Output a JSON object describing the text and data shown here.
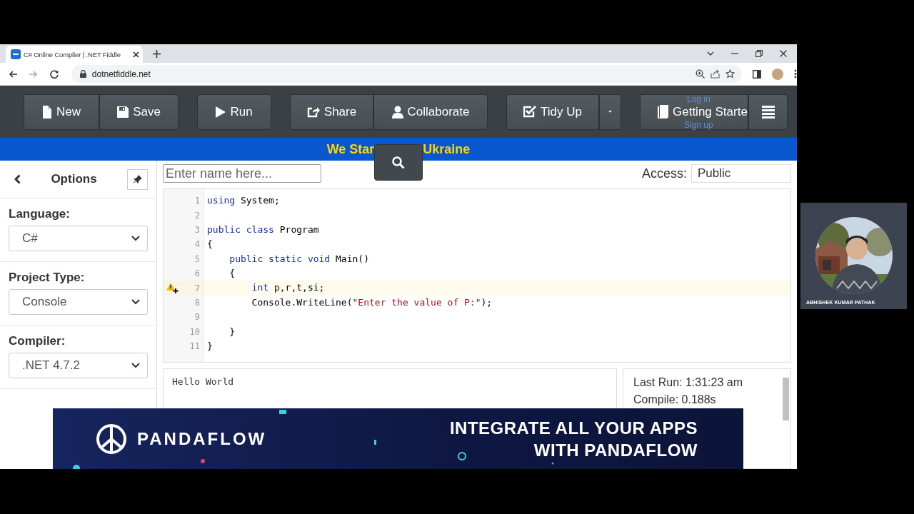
{
  "browser": {
    "tab": {
      "title": "C# Online Compiler | .NET Fiddle"
    },
    "nav": [
      {
        "kind": "back",
        "disabled": false
      },
      {
        "kind": "forward",
        "disabled": true
      },
      {
        "kind": "reload",
        "disabled": false
      }
    ],
    "address": "dotnetfiddle.net"
  },
  "toolbar": {
    "groups": [
      [
        {
          "kind": "new",
          "label": "New"
        },
        {
          "kind": "save",
          "label": "Save"
        }
      ],
      [
        {
          "kind": "run",
          "label": "Run"
        }
      ],
      [
        {
          "kind": "share",
          "label": "Share"
        },
        {
          "kind": "collaborate",
          "label": "Collaborate"
        }
      ],
      [
        {
          "kind": "tidy",
          "label": "Tidy Up"
        },
        {
          "kind": "caret"
        }
      ],
      [
        {
          "kind": "guide",
          "label": "Getting Starte"
        },
        {
          "kind": "menu"
        }
      ]
    ],
    "account_links": [
      "Log in",
      "Sign up"
    ]
  },
  "banner": {
    "parts": [
      "We Star",
      "Ukraine"
    ]
  },
  "sidebar": {
    "title": "Options",
    "fields": [
      {
        "label": "Language:",
        "value": "C#"
      },
      {
        "label": "Project Type:",
        "value": "Console"
      },
      {
        "label": "Compiler:",
        "value": ".NET 4.7.2"
      }
    ]
  },
  "name_field": {
    "placeholder": "Enter name here..."
  },
  "access": {
    "label": "Access:",
    "value": "Public"
  },
  "editor": {
    "lines": [
      {
        "number": "1",
        "warning": false,
        "tokens": [
          {
            "text": "using",
            "kind": "keyword"
          },
          {
            "text": " System;",
            "kind": "plain"
          }
        ]
      },
      {
        "number": "2",
        "warning": false
      },
      {
        "number": "3",
        "warning": false,
        "tokens": [
          {
            "text": "public class",
            "kind": "keyword"
          },
          {
            "text": " Program",
            "kind": "plain"
          }
        ]
      },
      {
        "number": "4",
        "warning": false,
        "tokens": [
          {
            "text": "{",
            "kind": "plain"
          }
        ]
      },
      {
        "number": "5",
        "warning": false,
        "tokens": [
          {
            "text": "    public static void",
            "kind": "keyword"
          },
          {
            "text": " Main()",
            "kind": "plain"
          }
        ]
      },
      {
        "number": "6",
        "warning": false,
        "tokens": [
          {
            "text": "    {",
            "kind": "plain"
          }
        ]
      },
      {
        "number": "7",
        "warning": true,
        "tokens": [
          {
            "text": "        int",
            "kind": "keyword"
          },
          {
            "text": " p,r,t,si;",
            "kind": "plain"
          }
        ]
      },
      {
        "number": "8",
        "warning": false,
        "tokens": [
          {
            "text": "        Console.WriteLine(",
            "kind": "plain"
          },
          {
            "text": "\"Enter the value of P:\"",
            "kind": "string"
          },
          {
            "text": ");",
            "kind": "plain"
          }
        ]
      },
      {
        "number": "9",
        "warning": false
      },
      {
        "number": "10",
        "warning": false,
        "tokens": [
          {
            "text": "    }",
            "kind": "plain"
          }
        ]
      },
      {
        "number": "11",
        "warning": false,
        "tokens": [
          {
            "text": "}",
            "kind": "plain"
          }
        ]
      }
    ]
  },
  "output": {
    "text": "Hello World"
  },
  "stats": [
    {
      "label": "Last Run:",
      "value": "1:31:23 am"
    },
    {
      "label": "Compile:",
      "value": "0.188s"
    }
  ],
  "ad": {
    "brand": "PANDAFLOW",
    "headline": [
      "INTEGRATE ALL YOUR APPS",
      "WITH **PANDAFLOW**"
    ]
  },
  "presenter": {
    "name": "ABHISHEK KUMAR PATHAK"
  }
}
